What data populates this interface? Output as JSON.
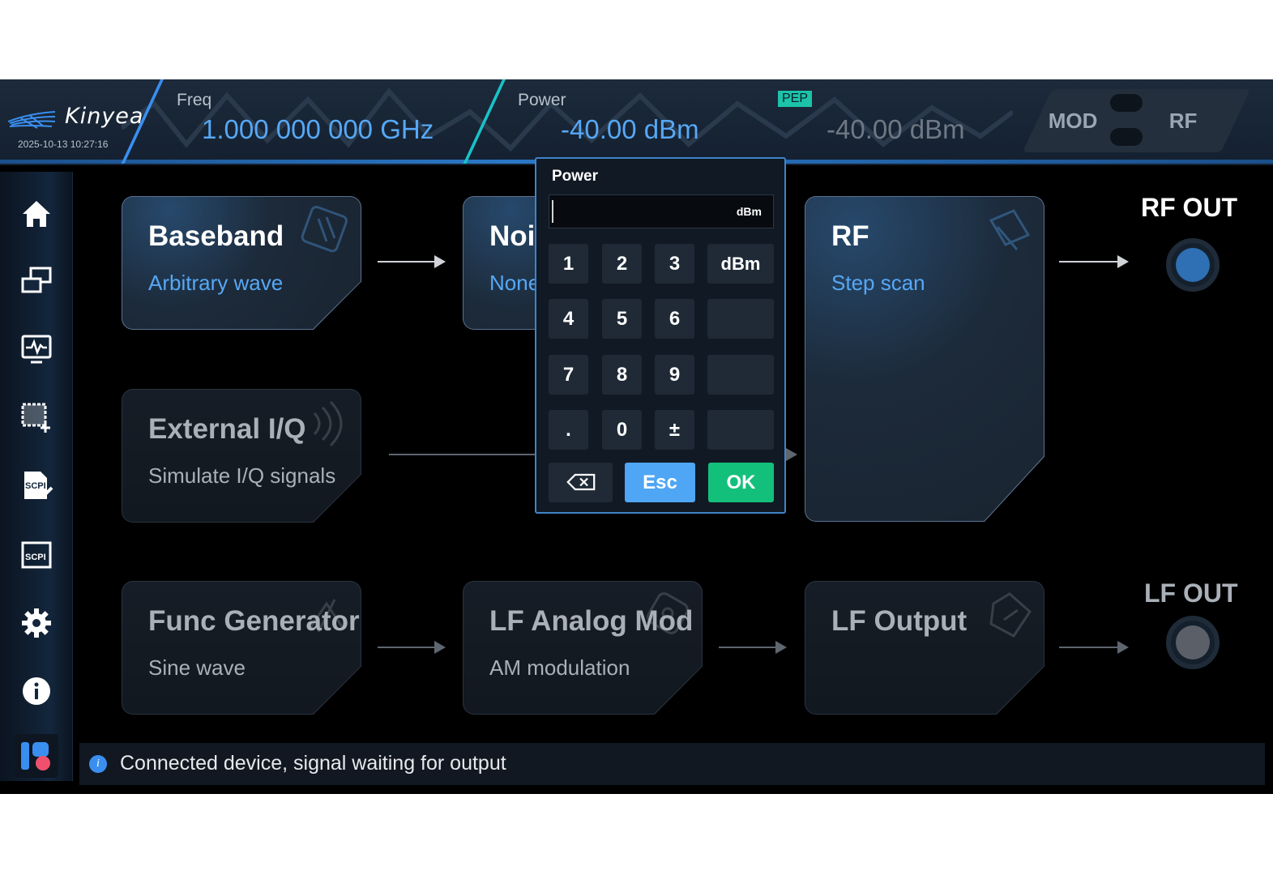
{
  "header": {
    "brand": "Kinyea",
    "datetime": "2025-10-13 10:27:16",
    "freq_label": "Freq",
    "freq_value": "1.000 000 000  GHz",
    "power_label": "Power",
    "power_value": "-40.00  dBm",
    "pep_badge": "PEP",
    "pep_value": "-40.00  dBm",
    "mod_label": "MOD",
    "rf_label": "RF"
  },
  "sidebar": {
    "items": [
      {
        "icon": "home-icon"
      },
      {
        "icon": "windows-icon"
      },
      {
        "icon": "monitor-icon"
      },
      {
        "icon": "screenshot-icon"
      },
      {
        "icon": "scpi-edit-icon",
        "text": "SCPI"
      },
      {
        "icon": "scpi-icon",
        "text": "SCPI"
      },
      {
        "icon": "gear-icon"
      },
      {
        "icon": "info-icon"
      },
      {
        "icon": "app-logo-icon"
      }
    ]
  },
  "blocks": {
    "baseband": {
      "title": "Baseband",
      "subtitle": "Arbitrary wave"
    },
    "noise": {
      "title": "Noi",
      "subtitle": "None"
    },
    "rf": {
      "title": "RF",
      "subtitle": "Step scan"
    },
    "external_iq": {
      "title": "External I/Q",
      "subtitle": "Simulate I/Q signals"
    },
    "func_generator": {
      "title": "Func Generator",
      "subtitle": "Sine wave"
    },
    "lf_analog_mod": {
      "title": "LF Analog Mod",
      "subtitle": "AM modulation"
    },
    "lf_output": {
      "title": "LF Output",
      "subtitle": ""
    }
  },
  "outputs": {
    "rf_out": {
      "label": "RF OUT",
      "color": "#2f6fb3"
    },
    "lf_out": {
      "label": "LF OUT",
      "color": "#5b6068"
    }
  },
  "status": {
    "message": "Connected device, signal waiting for output"
  },
  "keypad": {
    "title": "Power",
    "value": "",
    "unit": "dBm",
    "keys": {
      "k1": "1",
      "k2": "2",
      "k3": "3",
      "unit": "dBm",
      "k4": "4",
      "k5": "5",
      "k6": "6",
      "k7": "7",
      "k8": "8",
      "k9": "9",
      "dot": ".",
      "k0": "0",
      "sign": "±",
      "esc": "Esc",
      "ok": "OK"
    }
  },
  "colors": {
    "accent": "#56a8f5",
    "ok": "#13c07b",
    "esc": "#4ea6f4",
    "pep": "#1cc3a8"
  }
}
